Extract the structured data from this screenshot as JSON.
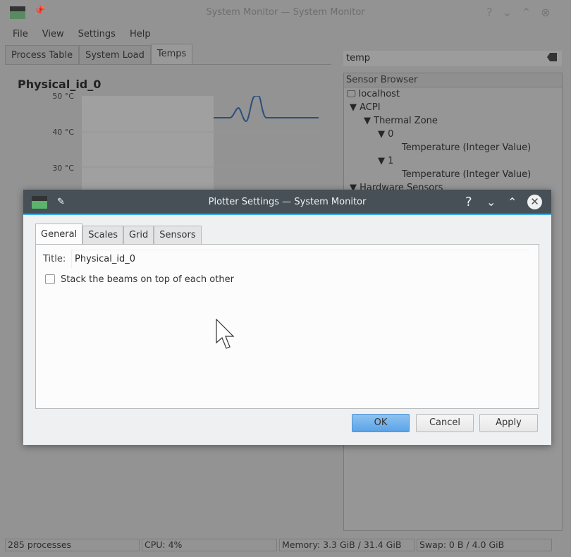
{
  "window": {
    "title": "System Monitor — System Monitor"
  },
  "menu": [
    "File",
    "View",
    "Settings",
    "Help"
  ],
  "tabs": [
    "Process Table",
    "System Load",
    "Temps"
  ],
  "plot": {
    "title": "Physical_id_0",
    "yticks": [
      "50 °C",
      "40 °C",
      "30 °C"
    ],
    "line_color": "#2c4f7c"
  },
  "search": {
    "value": "temp"
  },
  "sensor_browser": {
    "header": "Sensor Browser",
    "items": [
      "localhost",
      "▼ ACPI",
      "▼ Thermal Zone",
      "▼ 0",
      "Temperature (Integer Value)",
      "▼ 1",
      "Temperature (Integer Value)",
      "▼ Hardware Sensors"
    ]
  },
  "status": [
    "285 processes",
    "CPU: 4%",
    "Memory: 3.3 GiB / 31.4 GiB",
    "Swap: 0 B / 4.0 GiB"
  ],
  "dialog": {
    "title": "Plotter Settings — System Monitor",
    "tabs": [
      "General",
      "Scales",
      "Grid",
      "Sensors"
    ],
    "title_label": "Title:",
    "title_value": "Physical_id_0",
    "stack_label": "Stack the beams on top of each other",
    "stack_checked": false,
    "ok": "OK",
    "cancel": "Cancel",
    "apply": "Apply",
    "accent": "#3daee9"
  }
}
